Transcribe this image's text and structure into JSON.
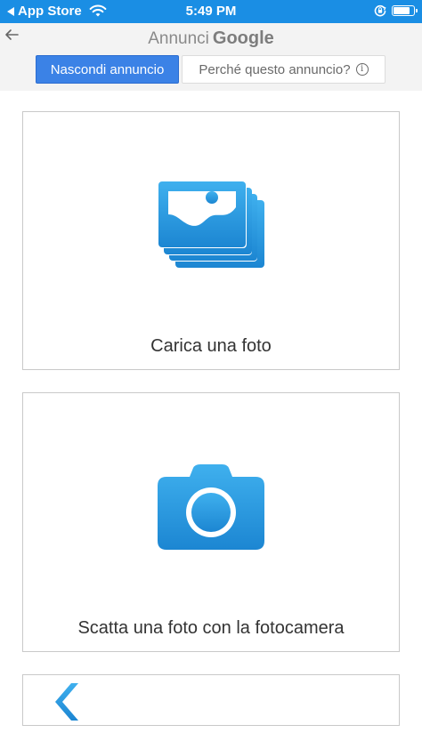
{
  "status_bar": {
    "back_app": "App Store",
    "time": "5:49 PM",
    "battery_level": 0.85,
    "icons": [
      "back-triangle-icon",
      "wifi-icon",
      "orientation-lock-icon",
      "battery-icon"
    ]
  },
  "ad_header": {
    "title_prefix": "Annunci",
    "title_brand": "Google",
    "hide_button": "Nascondi annuncio",
    "why_button": "Perché questo annuncio?",
    "info_glyph": "i",
    "icons": [
      "back-arrow-icon",
      "info-icon"
    ]
  },
  "options": [
    {
      "label": "Carica una foto",
      "icon": "photo-gallery-icon"
    },
    {
      "label": "Scatta una foto con la fotocamera",
      "icon": "camera-icon"
    }
  ],
  "footer": {
    "icon": "chevron-left-icon"
  },
  "colors": {
    "status_bar": "#1a8ee4",
    "hide_button": "#3b82e6",
    "icon_gradient_top": "#3fb0ee",
    "icon_gradient_bottom": "#1c86d2"
  }
}
